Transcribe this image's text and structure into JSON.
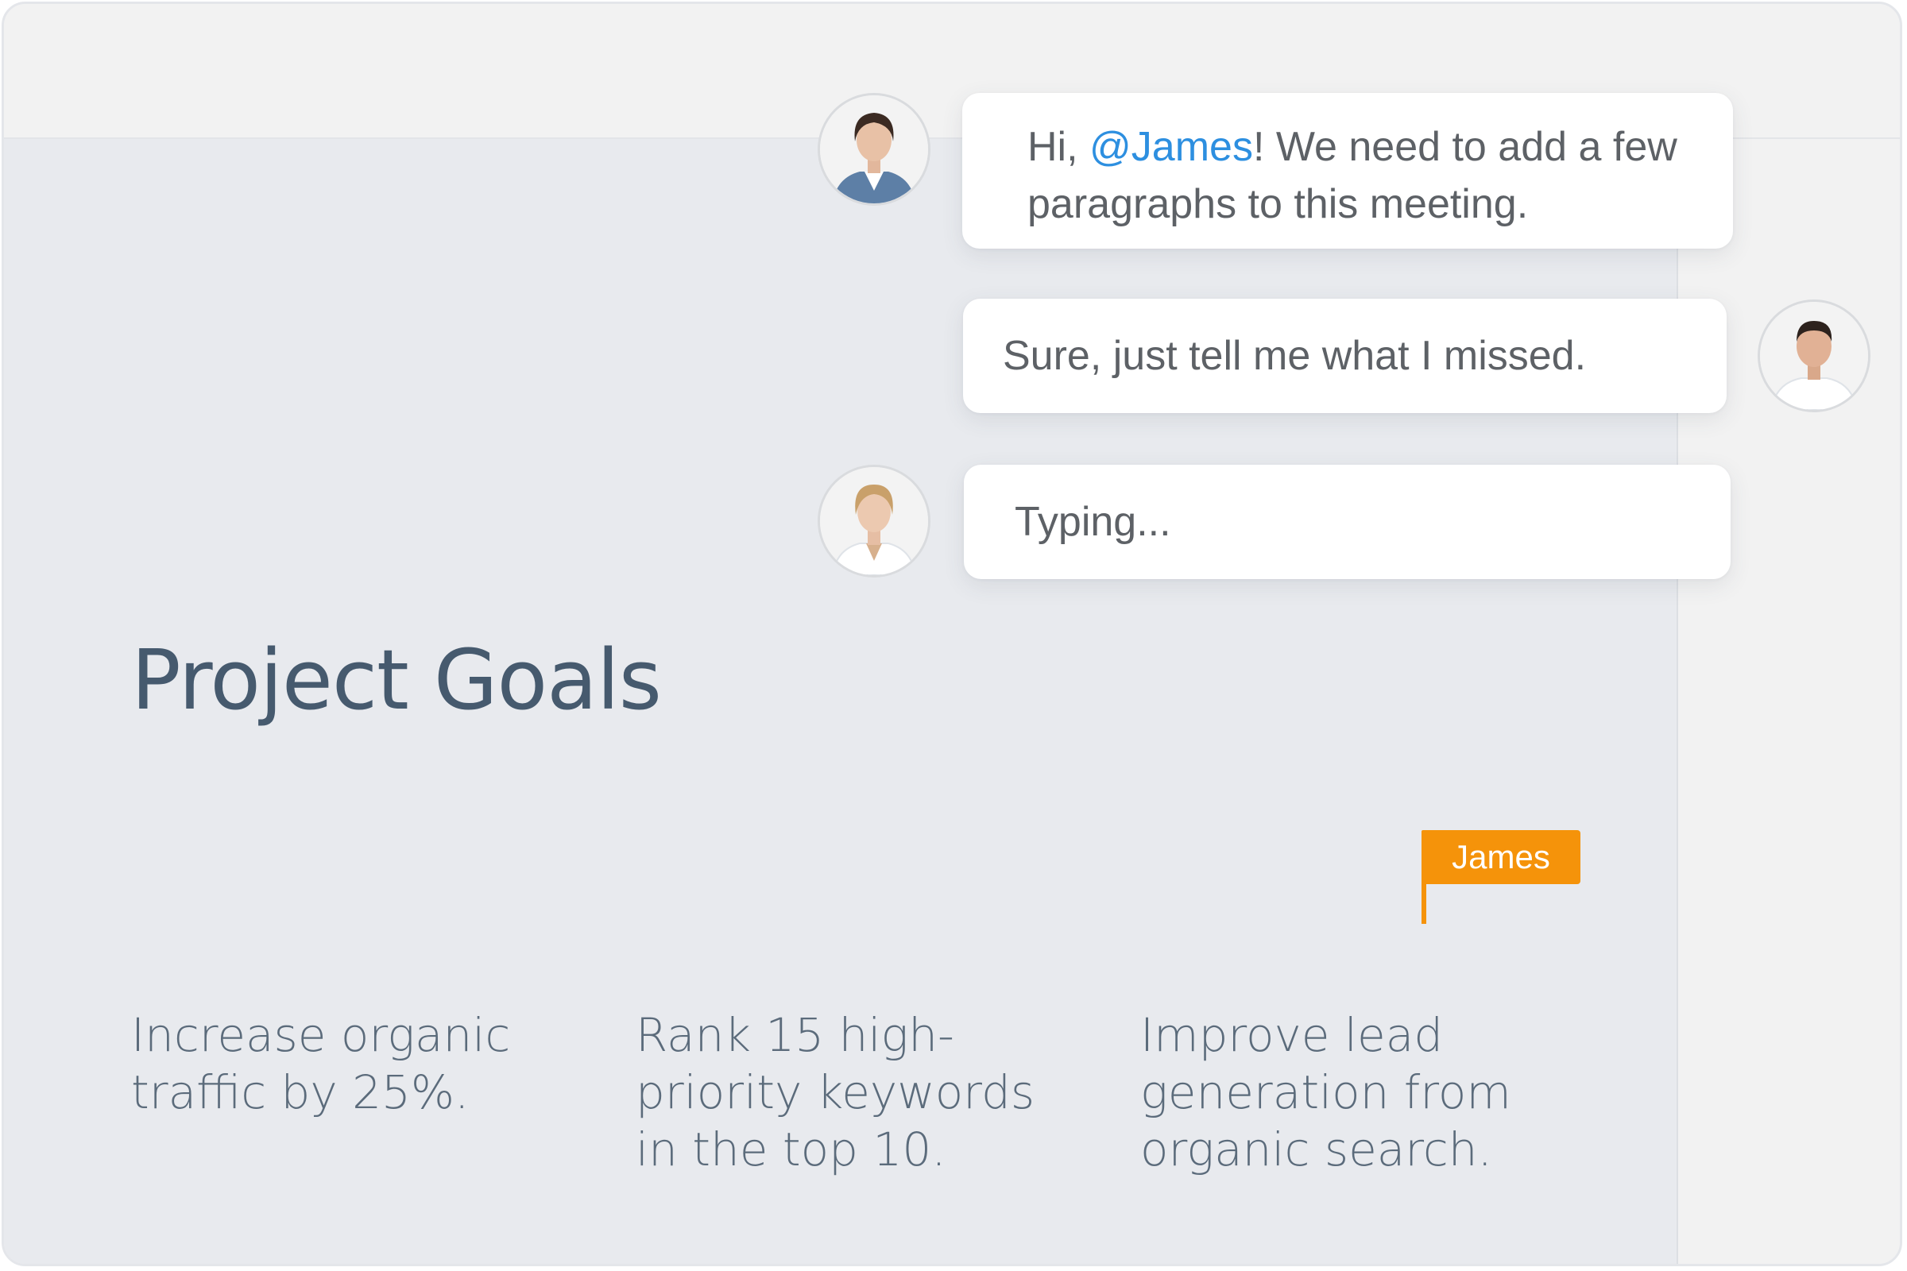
{
  "slide": {
    "title": "Project Goals",
    "goals": [
      "Increase organic traffic by 25%.",
      "Rank 15 high-priority keywords in the top 10.",
      "Improve lead generation from organic search."
    ]
  },
  "collaborator_cursor": {
    "name": "James",
    "color": "#f5930a"
  },
  "chat": {
    "messages": [
      {
        "prefix": "Hi, ",
        "mention": "@James",
        "text": "! We need to add a few paragraphs to this meeting."
      },
      {
        "text": "Sure, just tell me what I missed."
      },
      {
        "text": "Typing..."
      }
    ]
  },
  "colors": {
    "mention": "#2d8fe0",
    "title": "#465a6e",
    "slide_background": "#e8eaee"
  }
}
